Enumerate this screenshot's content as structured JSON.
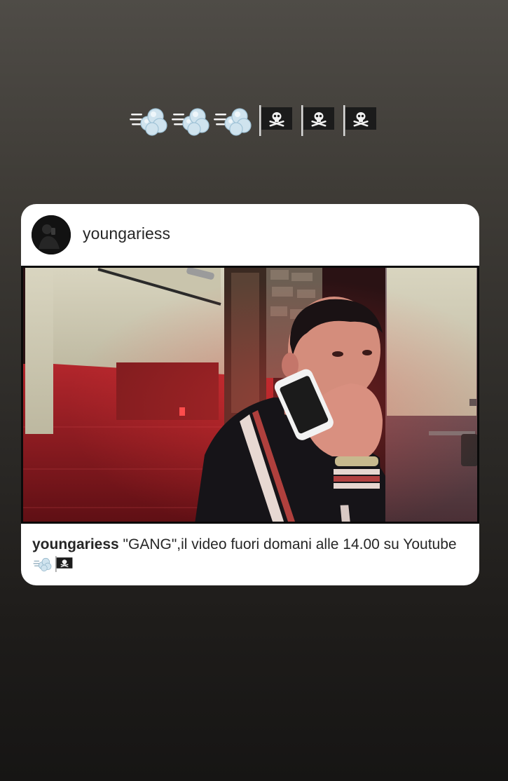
{
  "story": {
    "emoji_row": [
      {
        "icon": "dash-icon"
      },
      {
        "icon": "dash-icon"
      },
      {
        "icon": "dash-icon"
      },
      {
        "icon": "pirate-flag-icon"
      },
      {
        "icon": "pirate-flag-icon"
      },
      {
        "icon": "pirate-flag-icon"
      }
    ]
  },
  "post": {
    "username": "youngariess",
    "caption_user": "youngariess",
    "caption_text": " \"GANG\",il video fuori domani alle 14.00 su Youtube",
    "caption_emojis": [
      "dash-icon",
      "pirate-flag-icon"
    ]
  }
}
